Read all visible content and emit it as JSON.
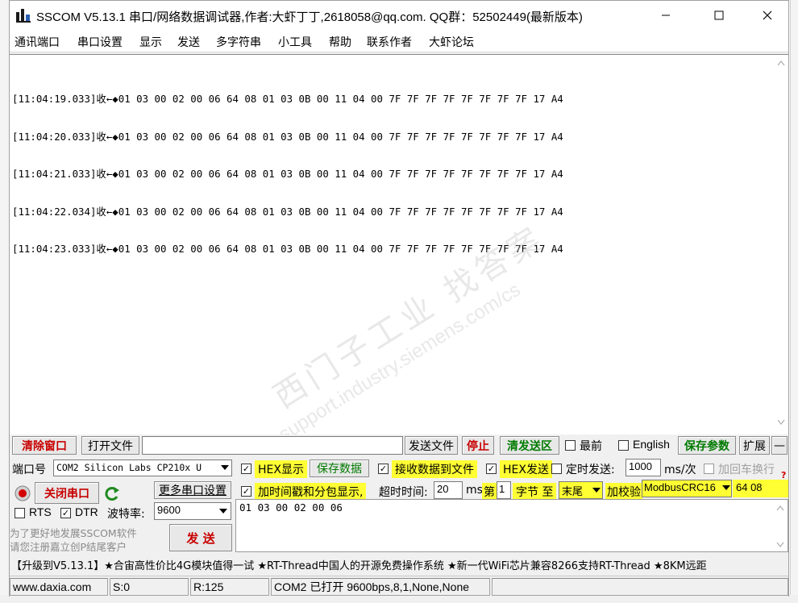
{
  "window": {
    "title": "SSCOM V5.13.1 串口/网络数据调试器,作者:大虾丁丁,2618058@qq.com. QQ群：52502449(最新版本)"
  },
  "menu": [
    "通讯端口",
    "串口设置",
    "显示",
    "发送",
    "多字符串",
    "小工具",
    "帮助",
    "联系作者",
    "大虾论坛"
  ],
  "receive": {
    "lines": [
      "[11:04:19.033]收←◆01 03 00 02 00 06 64 08 01 03 0B 00 11 04 00 7F 7F 7F 7F 7F 7F 7F 7F 17 A4",
      "[11:04:20.033]收←◆01 03 00 02 00 06 64 08 01 03 0B 00 11 04 00 7F 7F 7F 7F 7F 7F 7F 7F 17 A4",
      "[11:04:21.033]收←◆01 03 00 02 00 06 64 08 01 03 0B 00 11 04 00 7F 7F 7F 7F 7F 7F 7F 7F 17 A4",
      "[11:04:22.034]收←◆01 03 00 02 00 06 64 08 01 03 0B 00 11 04 00 7F 7F 7F 7F 7F 7F 7F 7F 17 A4",
      "[11:04:23.033]收←◆01 03 00 02 00 06 64 08 01 03 0B 00 11 04 00 7F 7F 7F 7F 7F 7F 7F 7F 17 A4"
    ]
  },
  "watermark": {
    "line1": "西门子工业  找答案",
    "line2": "support.industry.siemens.com/cs"
  },
  "toolbar": {
    "clear_window": "清除窗口",
    "open_file": "打开文件",
    "send_file": "发送文件",
    "stop": "停止",
    "clear_send": "清发送区",
    "topmost": "最前",
    "english": "English",
    "save_params": "保存参数",
    "expand": "扩展",
    "collapse": "—"
  },
  "port": {
    "label": "端口号",
    "value": "COM2 Silicon Labs CP210x U",
    "close_port": "关闭串口",
    "more_settings": "更多串口设置",
    "rts": "RTS",
    "dtr": "DTR",
    "baud_label": "波特率:",
    "baud_value": "9600",
    "ad_line1": "为了更好地发展SSCOM软件",
    "ad_line2": "请您注册嘉立创P结尾客户",
    "send_button": "发 送"
  },
  "options": {
    "hex_display": "HEX显示",
    "save_data": "保存数据",
    "recv_to_file": "接收数据到文件",
    "hex_send": "HEX发送",
    "timed_send": "定时发送:",
    "interval_value": "1000",
    "interval_unit": "ms/次",
    "add_crlf": "加回车换行",
    "timestamp": "加时间戳和分包显示,",
    "timeout_label": "超时时间:",
    "timeout_value": "20",
    "timeout_unit": "ms",
    "nth_label": "第",
    "nth_value": "1",
    "byte_to": "字节 至",
    "end_value": "末尾",
    "checksum_label": "加校验",
    "checksum_value": "ModbusCRC16",
    "crc_value": "64 08"
  },
  "send": {
    "content": "01 03 00 02 00 06"
  },
  "ticker": "【升级到V5.13.1】★合宙高性价比4G模块值得一试 ★RT-Thread中国人的开源免费操作系统 ★新一代WiFi芯片兼容8266支持RT-Thread ★8KM远距",
  "status": {
    "website": "www.daxia.com",
    "sent": "S:0",
    "received": "R:125",
    "port_state": "COM2 已打开  9600bps,8,1,None,None"
  },
  "colors": {
    "highlight": "#ffff33",
    "danger_text": "#c80000",
    "ok_text": "#007a00"
  }
}
